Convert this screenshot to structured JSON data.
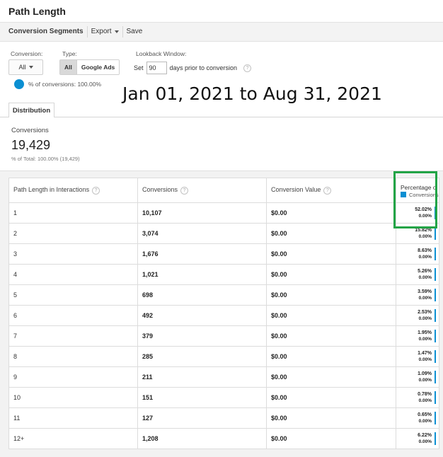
{
  "page": {
    "title": "Path Length"
  },
  "toolbar": {
    "items": [
      "Conversion Segments",
      "Export",
      "Save"
    ]
  },
  "filters": {
    "conversion_label": "Conversion:",
    "conversion_value": "All",
    "type_label": "Type:",
    "type_options": [
      "All",
      "Google Ads"
    ],
    "type_selected": "All",
    "lookback_label": "Lookback Window:",
    "lookback_prefix": "Set",
    "lookback_value": "90",
    "lookback_suffix": "days prior to conversion",
    "help_glyph": "?",
    "percent_of_conversions": "% of conversions: 100.00%"
  },
  "date_range": "Jan 01, 2021 to Aug 31, 2021",
  "tabs": [
    {
      "label": "Distribution"
    }
  ],
  "summary": {
    "label": "Conversions",
    "value": "19,429",
    "total": "% of Total: 100.00% (19,429)"
  },
  "table": {
    "columns": [
      "Path Length in Interactions",
      "Conversions",
      "Conversion Value",
      "Percentage of total"
    ],
    "pct_head_short": "Percentage o",
    "legend_label": "Conversions",
    "rows": [
      {
        "path": "1",
        "conversions": "10,107",
        "value": "$0.00",
        "pct": "52.02%",
        "pct2": "0.00%"
      },
      {
        "path": "2",
        "conversions": "3,074",
        "value": "$0.00",
        "pct": "15.82%",
        "pct2": "0.00%"
      },
      {
        "path": "3",
        "conversions": "1,676",
        "value": "$0.00",
        "pct": "8.63%",
        "pct2": "0.00%"
      },
      {
        "path": "4",
        "conversions": "1,021",
        "value": "$0.00",
        "pct": "5.26%",
        "pct2": "0.00%"
      },
      {
        "path": "5",
        "conversions": "698",
        "value": "$0.00",
        "pct": "3.59%",
        "pct2": "0.00%"
      },
      {
        "path": "6",
        "conversions": "492",
        "value": "$0.00",
        "pct": "2.53%",
        "pct2": "0.00%"
      },
      {
        "path": "7",
        "conversions": "379",
        "value": "$0.00",
        "pct": "1.95%",
        "pct2": "0.00%"
      },
      {
        "path": "8",
        "conversions": "285",
        "value": "$0.00",
        "pct": "1.47%",
        "pct2": "0.00%"
      },
      {
        "path": "9",
        "conversions": "211",
        "value": "$0.00",
        "pct": "1.09%",
        "pct2": "0.00%"
      },
      {
        "path": "10",
        "conversions": "151",
        "value": "$0.00",
        "pct": "0.78%",
        "pct2": "0.00%"
      },
      {
        "path": "11",
        "conversions": "127",
        "value": "$0.00",
        "pct": "0.65%",
        "pct2": "0.00%"
      },
      {
        "path": "12+",
        "conversions": "1,208",
        "value": "$0.00",
        "pct": "6.22%",
        "pct2": "0.00%"
      }
    ]
  },
  "colors": {
    "accent": "#0b8fd2",
    "highlight": "#22a446"
  }
}
